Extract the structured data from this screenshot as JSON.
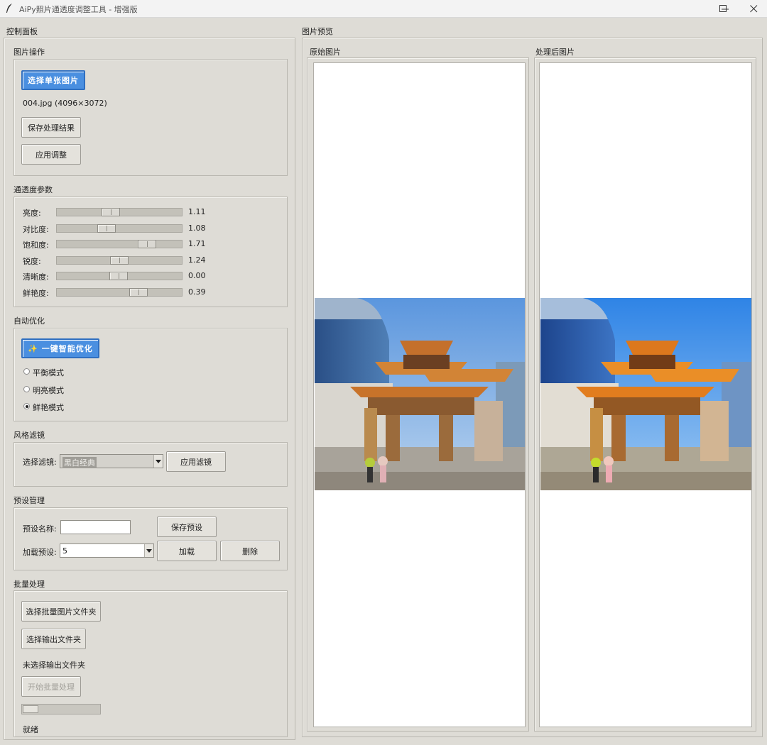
{
  "window": {
    "title": "AiPy照片通透度调整工具 - 增强版",
    "icon": "feather-icon"
  },
  "control_panel": {
    "title": "控制面板",
    "image_ops": {
      "title": "图片操作",
      "select_button": "选择单张图片",
      "file_info": "004.jpg (4096×3072)",
      "save_button": "保存处理结果",
      "apply_button": "应用调整"
    },
    "params": {
      "title": "通透度参数",
      "sliders": [
        {
          "label": "亮度:",
          "value": "1.11",
          "level": 0.42
        },
        {
          "label": "对比度:",
          "value": "1.08",
          "level": 0.38
        },
        {
          "label": "饱和度:",
          "value": "1.71",
          "level": 0.76
        },
        {
          "label": "锐度:",
          "value": "1.24",
          "level": 0.5
        },
        {
          "label": "清晰度:",
          "value": "0.00",
          "level": 0.49
        },
        {
          "label": "鲜艳度:",
          "value": "0.39",
          "level": 0.68
        }
      ]
    },
    "auto": {
      "title": "自动优化",
      "button": "✨ 一键智能优化",
      "modes": [
        {
          "label": "平衡模式",
          "checked": false
        },
        {
          "label": "明亮模式",
          "checked": false
        },
        {
          "label": "鲜艳模式",
          "checked": true
        }
      ]
    },
    "filter": {
      "title": "风格滤镜",
      "select_label": "选择滤镜:",
      "selected": "黑白经典",
      "apply_button": "应用滤镜"
    },
    "presets": {
      "title": "预设管理",
      "name_label": "预设名称:",
      "name_value": "",
      "save_button": "保存预设",
      "load_label": "加载预设:",
      "load_value": "5",
      "load_button": "加载",
      "delete_button": "删除"
    },
    "batch": {
      "title": "批量处理",
      "select_folder_button": "选择批量图片文件夹",
      "select_output_button": "选择输出文件夹",
      "output_status": "未选择输出文件夹",
      "start_button": "开始批量处理",
      "progress": 0.2,
      "status": "就绪"
    }
  },
  "preview": {
    "title": "图片预览",
    "original_label": "原始图片",
    "processed_label": "处理后图片"
  },
  "colors": {
    "accent": "#4a8fe0",
    "window_bg": "#dedcd6"
  }
}
